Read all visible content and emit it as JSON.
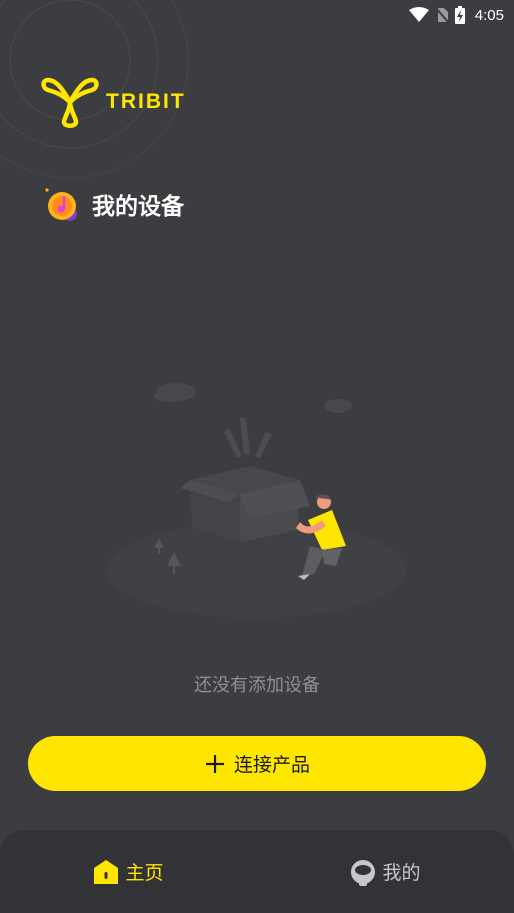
{
  "status_bar": {
    "time": "4:05",
    "icons": [
      "wifi-icon",
      "no-sim-icon",
      "battery-charging-icon"
    ]
  },
  "brand": {
    "logo_text": "TRIBIT",
    "logo_icon": "tribit-logo-icon",
    "accent_color": "#ffe600"
  },
  "section": {
    "title": "我的设备",
    "icon": "music-note-icon"
  },
  "empty_state": {
    "illustration": "empty-box-illustration",
    "message": "还没有添加设备"
  },
  "connect_button": {
    "icon": "plus-icon",
    "label": "连接产品"
  },
  "bottom_nav": {
    "items": [
      {
        "label": "主页",
        "icon": "home-icon",
        "active": true
      },
      {
        "label": "我的",
        "icon": "profile-icon",
        "active": false
      }
    ]
  },
  "colors": {
    "background": "#3c3d40",
    "nav_background": "#323336",
    "muted_text": "#8f9093"
  }
}
